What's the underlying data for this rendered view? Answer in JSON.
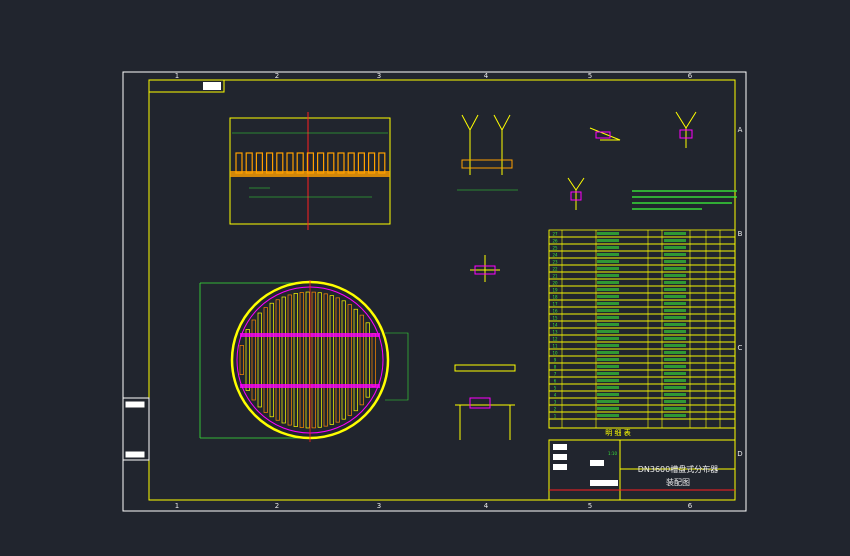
{
  "drawing": {
    "title": "DN3600槽盘式分布器",
    "subtitle": "装配图",
    "parts_list_caption": "明 细 表",
    "column_labels": [
      "1",
      "2",
      "3",
      "4",
      "5",
      "6"
    ],
    "row_labels": [
      "A",
      "B",
      "C",
      "D"
    ],
    "parts_rows": [
      "27",
      "26",
      "25",
      "24",
      "23",
      "22",
      "21",
      "20",
      "19",
      "18",
      "17",
      "16",
      "15",
      "14",
      "13",
      "12",
      "11",
      "10",
      "9",
      "8",
      "7",
      "6",
      "5",
      "4",
      "3",
      "2",
      "1"
    ],
    "scale": "1:10",
    "colors": {
      "background": "#21252e",
      "frame": "#ffffff",
      "border": "#ffff00",
      "dimension": "#39e639",
      "centerline": "#ff2020",
      "detail": "#ff00ff"
    }
  }
}
